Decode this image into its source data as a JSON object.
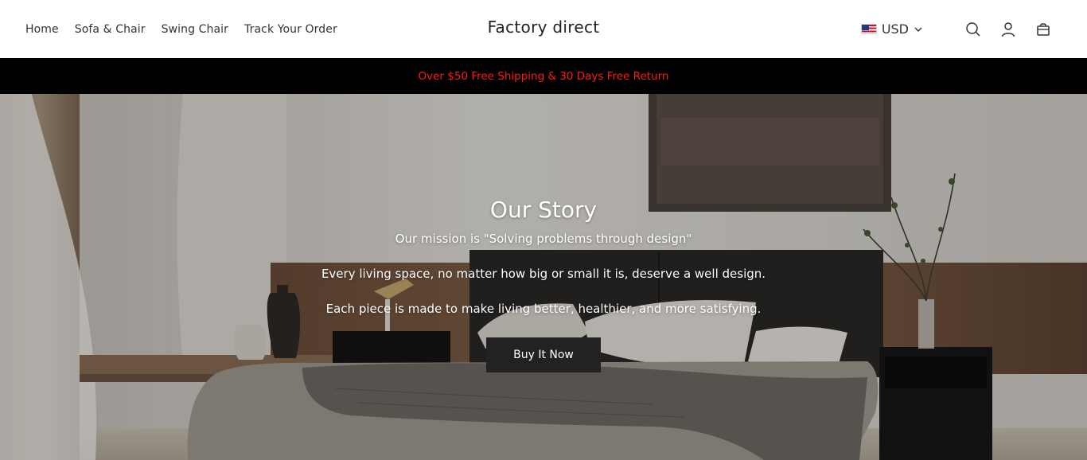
{
  "nav": {
    "items": [
      {
        "label": "Home"
      },
      {
        "label": "Sofa & Chair"
      },
      {
        "label": "Swing Chair"
      },
      {
        "label": "Track Your Order"
      }
    ]
  },
  "brand": {
    "name": "Factory direct"
  },
  "currency": {
    "code": "USD",
    "flag_icon": "us-flag-icon"
  },
  "header_icons": [
    "search-icon",
    "account-icon",
    "cart-icon"
  ],
  "announcement": {
    "text": "Over $50 Free Shipping & 30 Days Free Return",
    "text_color": "#ff1a1a",
    "background": "#000000"
  },
  "hero": {
    "title": "Our Story",
    "mission": "Our mission is \"Solving problems through design\"",
    "line1": "Every living space, no matter how big or small it is, deserve a well design.",
    "line2": "Each piece is made to make living better, healthier, and more satisfying.",
    "button_label": "Buy It Now",
    "button_color": "#222222"
  }
}
